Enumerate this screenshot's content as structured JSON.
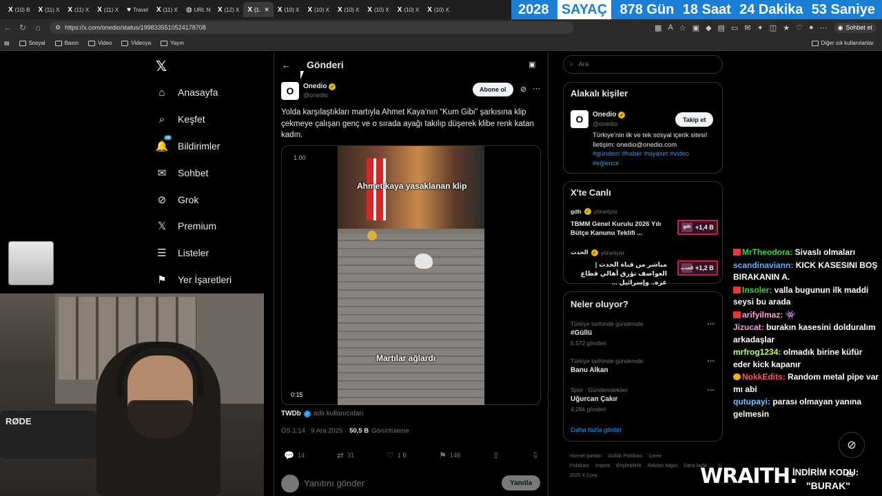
{
  "browser": {
    "tabs": [
      {
        "label": "(10) B",
        "icon": "x-icon"
      },
      {
        "label": "(11) X",
        "icon": "x-icon"
      },
      {
        "label": "(11) X",
        "icon": "x-icon"
      },
      {
        "label": "(11) X",
        "icon": "x-icon"
      },
      {
        "label": "Travel",
        "icon": "travel-icon"
      },
      {
        "label": "(11) X",
        "icon": "x-icon"
      },
      {
        "label": "URL N",
        "icon": "url-icon"
      },
      {
        "label": "(12) X",
        "icon": "x-icon"
      },
      {
        "label": "(1.",
        "icon": "x-icon",
        "active": true
      },
      {
        "label": "(10) X",
        "icon": "x-icon"
      },
      {
        "label": "(10) X",
        "icon": "x-icon"
      },
      {
        "label": "(10) X",
        "icon": "x-icon"
      },
      {
        "label": "(10) X",
        "icon": "x-icon"
      },
      {
        "label": "(10) X",
        "icon": "x-icon"
      },
      {
        "label": "(10) X",
        "icon": "x-icon"
      }
    ],
    "url": "https://x.com/onedio/status/1998335510524178708",
    "chat_button": "Sohbet et",
    "bookmarks": [
      "Sosyal",
      "Basın",
      "Video",
      "Videoya",
      "Yayın"
    ],
    "bookmarks_other": "Diğer sık kullanılanlar"
  },
  "counter": {
    "year": "2028",
    "label": "SAYAÇ",
    "days": "878 Gün",
    "hours": "18 Saat",
    "minutes": "24 Dakika",
    "seconds": "53 Saniye"
  },
  "nav": {
    "items": [
      {
        "label": "Anasayfa",
        "icon": "home-icon"
      },
      {
        "label": "Keşfet",
        "icon": "search-icon"
      },
      {
        "label": "Bildirimler",
        "icon": "bell-icon",
        "badge": "12"
      },
      {
        "label": "Sohbet",
        "icon": "mail-icon"
      },
      {
        "label": "Grok",
        "icon": "grok-icon"
      },
      {
        "label": "Premium",
        "icon": "x-icon"
      },
      {
        "label": "Listeler",
        "icon": "list-icon"
      },
      {
        "label": "Yer İşaretleri",
        "icon": "bookmark-icon"
      }
    ]
  },
  "webcam": {
    "mic_brand": "RØDE"
  },
  "post": {
    "header_title": "Gönderi",
    "author_name": "Onedio",
    "author_handle": "@onedio",
    "avatar_letter": "O",
    "follow_label": "Abone ol",
    "text": "Yolda karşılaştıkları martıyla Ahmet Kaya’nın “Kum Gibi” şarkısına klip çekmeye çalışan genç ve o sırada ayağı takılıp düşerek klibe renk katan kadın.",
    "video_speed": "1.00",
    "video_caption_top": "Ahmet kaya yasaklanan klip",
    "video_caption_bottom": "Martılar ağlardı",
    "video_time": "0:15",
    "from_user": "TWDb",
    "from_suffix": "adlı kullanıcıdan",
    "timestamp": "ÖS 1:14 · 9 Ara 2025 ·",
    "views_count": "50,5 B",
    "views_label": "Görüntüleme",
    "replies": "14",
    "reposts": "31",
    "likes": "1 B",
    "bookmarks": "148",
    "reply_placeholder": "Yanıtını gönder",
    "reply_button": "Yanıtla"
  },
  "sidebar": {
    "search_placeholder": "Ara",
    "people_title": "Alakalı kişiler",
    "person_name": "Onedio",
    "person_handle": "@onedio",
    "person_avatar_letter": "O",
    "person_follow": "Takip et",
    "person_bio": "Türkiye'nin ilk ve tek sosyal içerik sitesi! İletişim: onedio@onedio.com",
    "person_tags": "#gündem #haber #siyaset #video #eğlence",
    "live_title": "X'te Canlı",
    "live": [
      {
        "host": "gdh",
        "hosting": "yönetiyor",
        "title": "TBMM Genel Kurulu 2026 Yılı Bütçe Kanunu Teklifi ...",
        "count": "+1,4 B",
        "thumb": "gdh"
      },
      {
        "host": "الحدث",
        "hosting": "yönetiyor",
        "title": "مباشر من قناة الحدث | العواصف تؤرق أهالي قطاع غزة.. وإسرائيل ...",
        "count": "+1,2 B",
        "thumb": "الحدث"
      }
    ],
    "trends_title": "Neler oluyor?",
    "trends": [
      {
        "category": "Türkiye tarihinde gündemde",
        "name": "#Güllü",
        "count": "5.572 gönderi"
      },
      {
        "category": "Türkiye tarihinde gündemde",
        "name": "Banu Alkan",
        "count": ""
      },
      {
        "category": "Spor · Gündemdekiler",
        "name": "Uğurcan Çakır",
        "count": "4.284 gönderi"
      }
    ],
    "show_more": "Daha fazla göster",
    "footer": [
      "Hizmet Şartları",
      "Gizlilik Politikası",
      "Çerez Politikası",
      "Imprint",
      "Erişilebilirlik",
      "Reklam bilgisi",
      "Daha fazla ...",
      "© 2025 X Corp."
    ]
  },
  "chat": [
    {
      "user": "MrTheodora:",
      "text": " Sivaslı olmaları",
      "ucls": "u1",
      "tag": "tag"
    },
    {
      "user": "scandinaviann:",
      "text": " KICK KASESINI BOŞ BIRAKANIN A.",
      "ucls": "u2",
      "tag": ""
    },
    {
      "user": "Insoler:",
      "text": " valla bugunun ilk maddi seysi bu arada",
      "ucls": "u1",
      "tag": "tag"
    },
    {
      "user": "arifyilmaz:",
      "text": " 👾",
      "ucls": "u3",
      "tag": "tag"
    },
    {
      "user": "Jizucat:",
      "text": " burakın kasesini dolduralım arkadaşlar",
      "ucls": "u3",
      "tag": ""
    },
    {
      "user": "mrfrog1234:",
      "text": " olmadık birine küfür eder kick kapanır",
      "ucls": "u5",
      "tag": ""
    },
    {
      "user": "NokkEdits:",
      "text": " Random metal pipe var mı abi",
      "ucls": "u6",
      "tag": "tag y"
    },
    {
      "user": "qutupayi:",
      "text": " parası olmayan yanına gelmesin",
      "ucls": "u4",
      "tag": ""
    }
  ],
  "overlay": {
    "brand": "WRAITH.",
    "promo_line1": "İNDİRİM KODU:",
    "promo_line2": "\"BURAK\""
  }
}
